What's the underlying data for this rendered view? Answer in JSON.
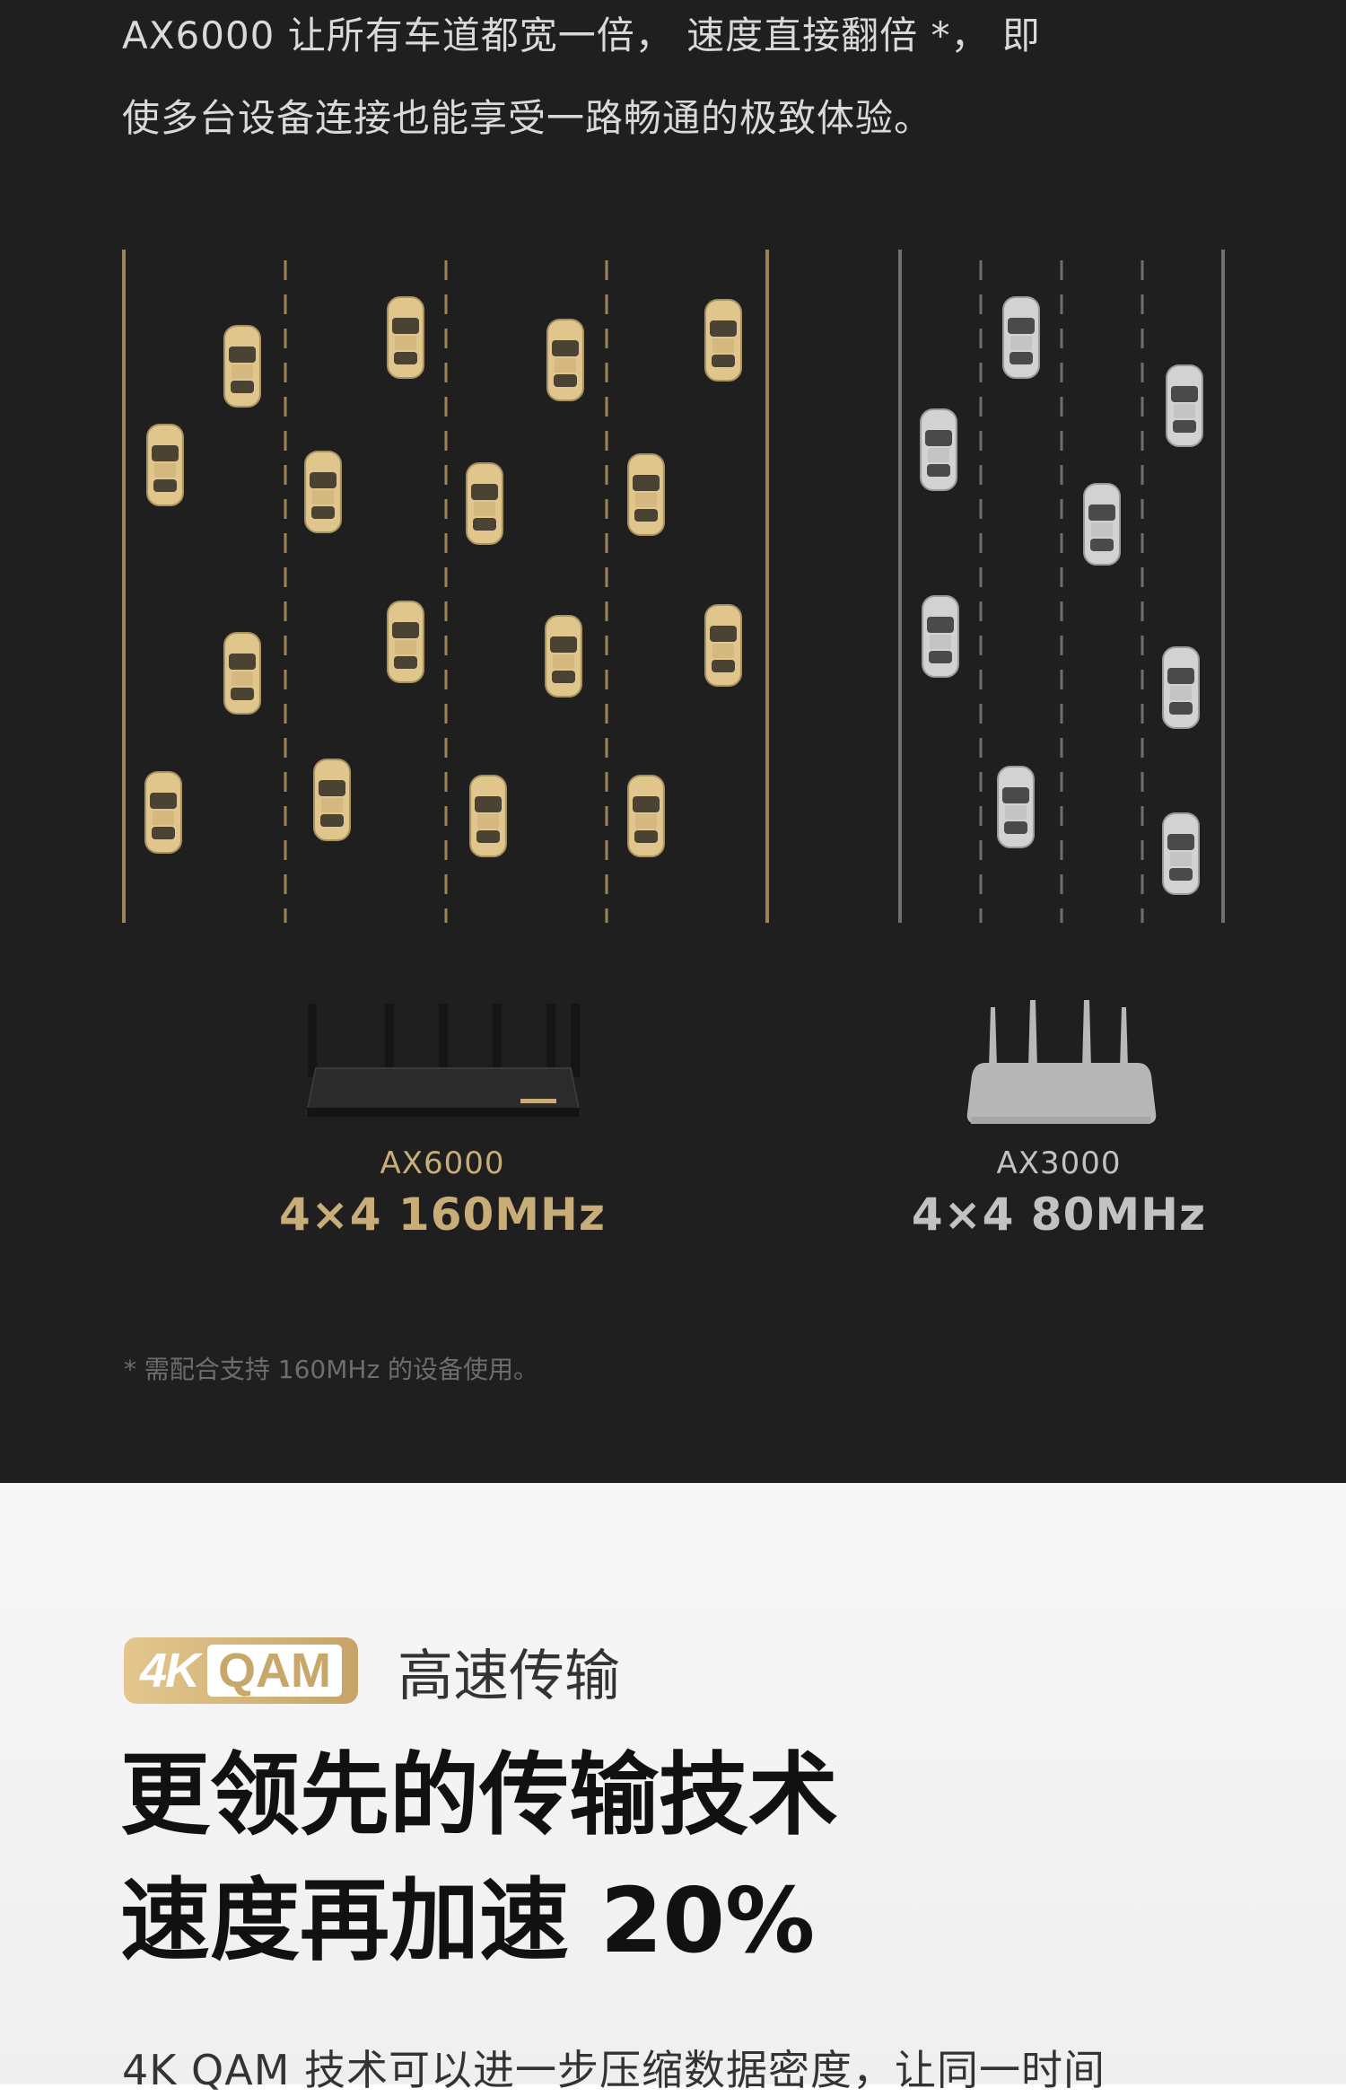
{
  "intro": {
    "line1": "AX6000 让所有车道都宽一倍， 速度直接翻倍 *， 即",
    "line2": "使多台设备连接也能享受一路畅通的极致体验。"
  },
  "comparison": {
    "left": {
      "model": "AX6000",
      "spec": "4×4 160MHz",
      "color": "#c9ad79"
    },
    "right": {
      "model": "AX3000",
      "spec": "4×4 80MHz",
      "color": "#c2c2c2"
    }
  },
  "footnote": "* 需配合支持 160MHz 的设备使用。",
  "feature": {
    "badge_4k": "4K",
    "badge_qam": "QAM",
    "badge_caption": "高速传输",
    "headline_line1": "更领先的传输技术",
    "headline_line2": "速度再加速 20%",
    "body_text": "4K QAM 技术可以进一步压缩数据密度，让同一时间"
  },
  "colors": {
    "dark_bg": "#1f1f1f",
    "gold": "#c9ad79",
    "silver": "#c2c2c2",
    "light_bg": "#f4f4f4"
  },
  "icons": [
    "car-icon-gold",
    "car-icon-silver",
    "router-ax6000-icon",
    "router-ax3000-icon"
  ]
}
